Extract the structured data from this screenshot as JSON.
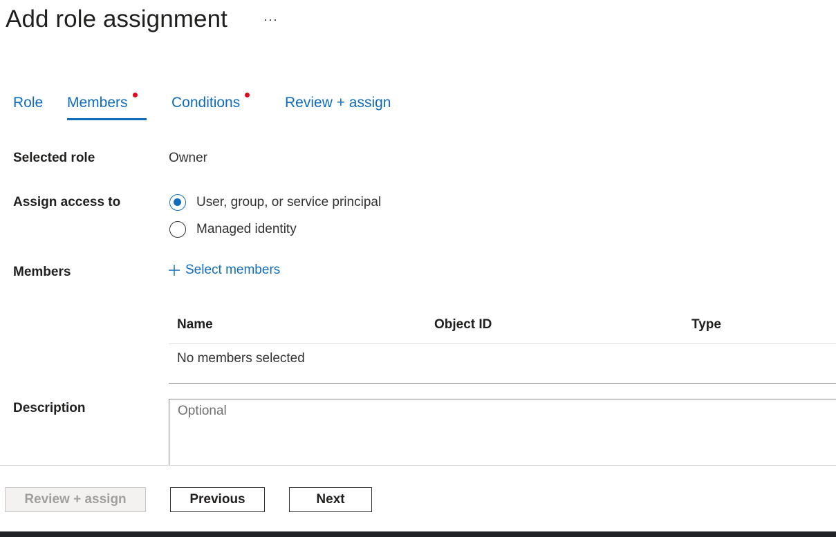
{
  "header": {
    "title": "Add role assignment",
    "more_label": "···"
  },
  "tabs": [
    {
      "label": "Role",
      "active": false,
      "dot": false
    },
    {
      "label": "Members",
      "active": true,
      "dot": true
    },
    {
      "label": "Conditions",
      "active": false,
      "dot": true
    },
    {
      "label": "Review + assign",
      "active": false,
      "dot": false
    }
  ],
  "form": {
    "selected_role_label": "Selected role",
    "selected_role_value": "Owner",
    "assign_access_label": "Assign access to",
    "assign_options": [
      {
        "label": "User, group, or service principal",
        "checked": true
      },
      {
        "label": "Managed identity",
        "checked": false
      }
    ],
    "members_label": "Members",
    "select_members_label": "Select members",
    "description_label": "Description",
    "description_placeholder": "Optional",
    "description_value": ""
  },
  "members_table": {
    "columns": [
      "Name",
      "Object ID",
      "Type"
    ],
    "empty_text": "No members selected"
  },
  "footer": {
    "review_assign_label": "Review + assign",
    "review_assign_disabled": true,
    "previous_label": "Previous",
    "next_label": "Next"
  },
  "colors": {
    "accent": "#0f6cbd",
    "required_dot": "#e00b1c",
    "taskbar": "#202226"
  }
}
